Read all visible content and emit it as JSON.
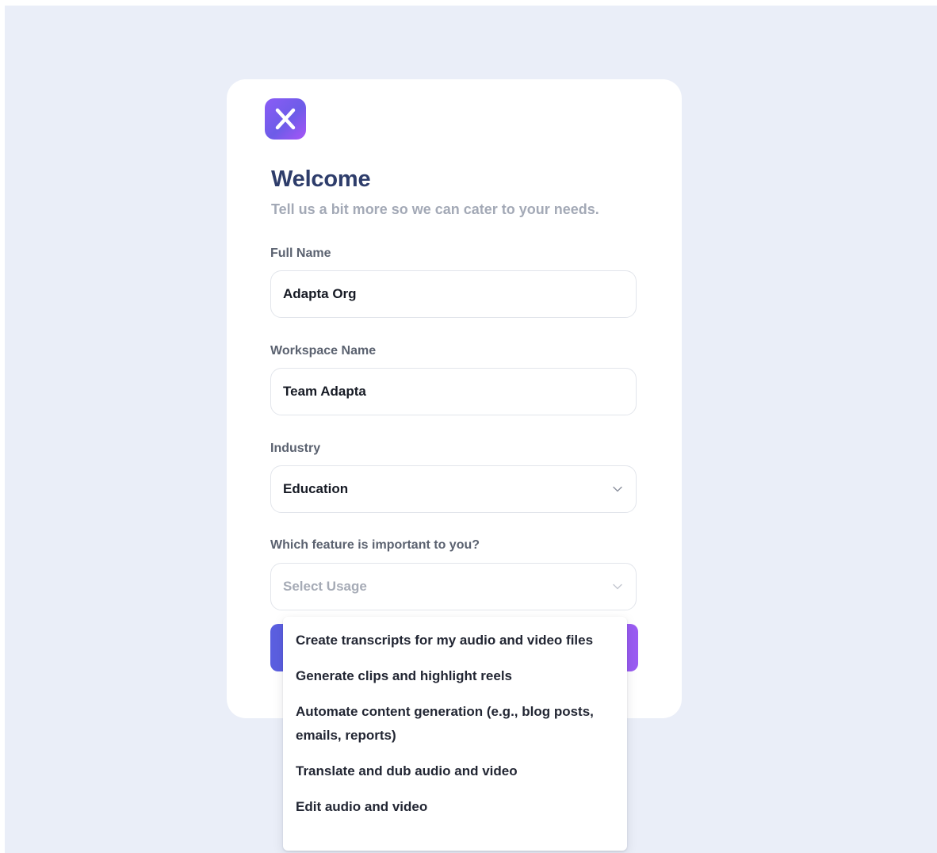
{
  "logo": {
    "icon": "x-logo-icon",
    "colors": [
      "#8b5cf6",
      "#6d5ce8",
      "#a855f7"
    ]
  },
  "header": {
    "title": "Welcome",
    "subtitle": "Tell us a bit more so we can cater to your needs."
  },
  "form": {
    "full_name": {
      "label": "Full Name",
      "value": "Adapta Org"
    },
    "workspace_name": {
      "label": "Workspace Name",
      "value": "Team Adapta"
    },
    "industry": {
      "label": "Industry",
      "value": "Education"
    },
    "feature": {
      "label": "Which feature is important to you?",
      "placeholder": "Select Usage",
      "options": [
        "Create transcripts for my audio and video files",
        "Generate clips and highlight reels",
        "Automate content generation (e.g., blog posts, emails, reports)",
        "Translate and dub audio and video",
        "Edit audio and video"
      ]
    }
  },
  "colors": {
    "background": "#eaeef8",
    "title": "#2e3d6b",
    "accent_start": "#5a5fe0",
    "accent_end": "#9b5cf2"
  }
}
